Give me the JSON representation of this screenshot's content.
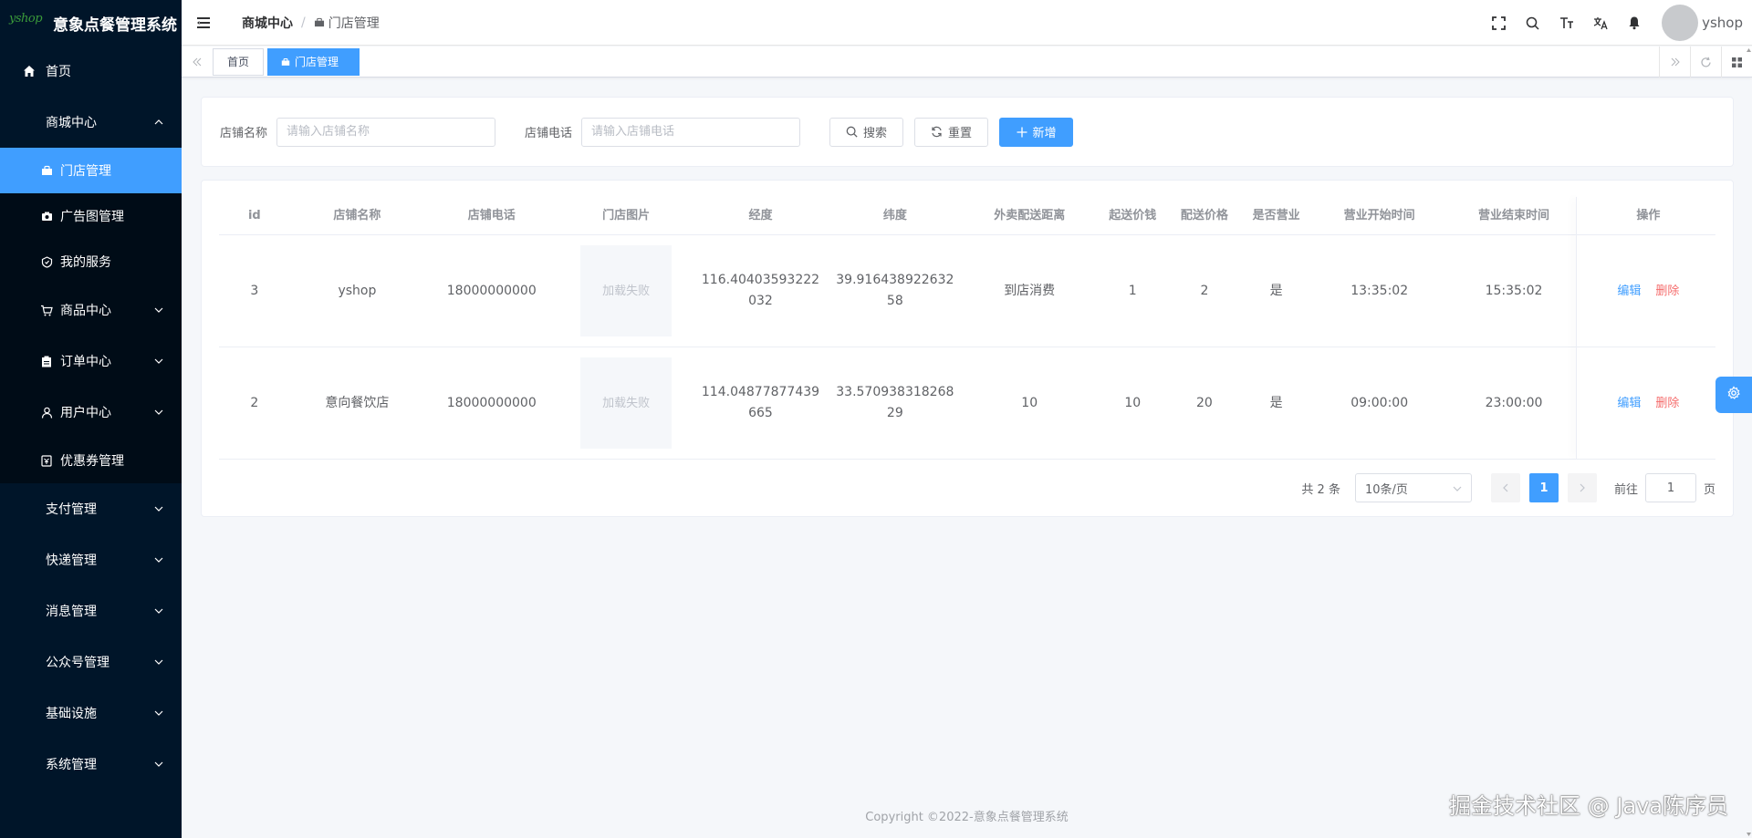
{
  "app": {
    "logo_text": "yshop",
    "title": "意象点餐管理系统"
  },
  "sidebar": {
    "home": "首页",
    "mall_center": "商城中心",
    "mall_sub": [
      "门店管理",
      "广告图管理",
      "我的服务"
    ],
    "goods_center": "商品中心",
    "order_center": "订单中心",
    "user_center": "用户中心",
    "coupon": "优惠券管理",
    "groups": [
      "支付管理",
      "快递管理",
      "消息管理",
      "公众号管理",
      "基础设施",
      "系统管理"
    ]
  },
  "navbar": {
    "breadcrumb_first": "商城中心",
    "breadcrumb_sep": "/",
    "breadcrumb_current": "门店管理",
    "username": "yshop"
  },
  "tags": {
    "home": "首页",
    "active": "门店管理"
  },
  "search": {
    "name_label": "店铺名称",
    "name_placeholder": "请输入店铺名称",
    "phone_label": "店铺电话",
    "phone_placeholder": "请输入店铺电话",
    "search_btn": "搜索",
    "reset_btn": "重置",
    "add_btn": "新增"
  },
  "table": {
    "headers": [
      "id",
      "店铺名称",
      "店铺电话",
      "门店图片",
      "经度",
      "纬度",
      "外卖配送距离",
      "起送价钱",
      "配送价格",
      "是否营业",
      "营业开始时间",
      "营业结束时间",
      "操作"
    ],
    "rows": [
      {
        "id": "3",
        "name": "yshop",
        "phone": "18000000000",
        "image": "加载失败",
        "lng": "116.40403593222032",
        "lat": "39.91643892263258",
        "distance": "到店消费",
        "min_price": "1",
        "delivery_price": "2",
        "open": "是",
        "start": "13:35:02",
        "end": "15:35:02"
      },
      {
        "id": "2",
        "name": "意向餐饮店",
        "phone": "18000000000",
        "image": "加载失败",
        "lng": "114.04877877439665",
        "lat": "33.57093831826829",
        "distance": "10",
        "min_price": "10",
        "delivery_price": "20",
        "open": "是",
        "start": "09:00:00",
        "end": "23:00:00"
      }
    ],
    "edit": "编辑",
    "delete": "删除"
  },
  "pagination": {
    "total": "共 2 条",
    "page_size": "10条/页",
    "current": "1",
    "goto_label": "前往",
    "goto_value": "1",
    "page_unit": "页"
  },
  "footer": "Copyright ©2022-意象点餐管理系统",
  "watermark": "掘金技术社区 @ Java陈序员",
  "colors": {
    "primary": "#409eff",
    "sidebar": "#001529",
    "danger": "#f56c6c"
  }
}
